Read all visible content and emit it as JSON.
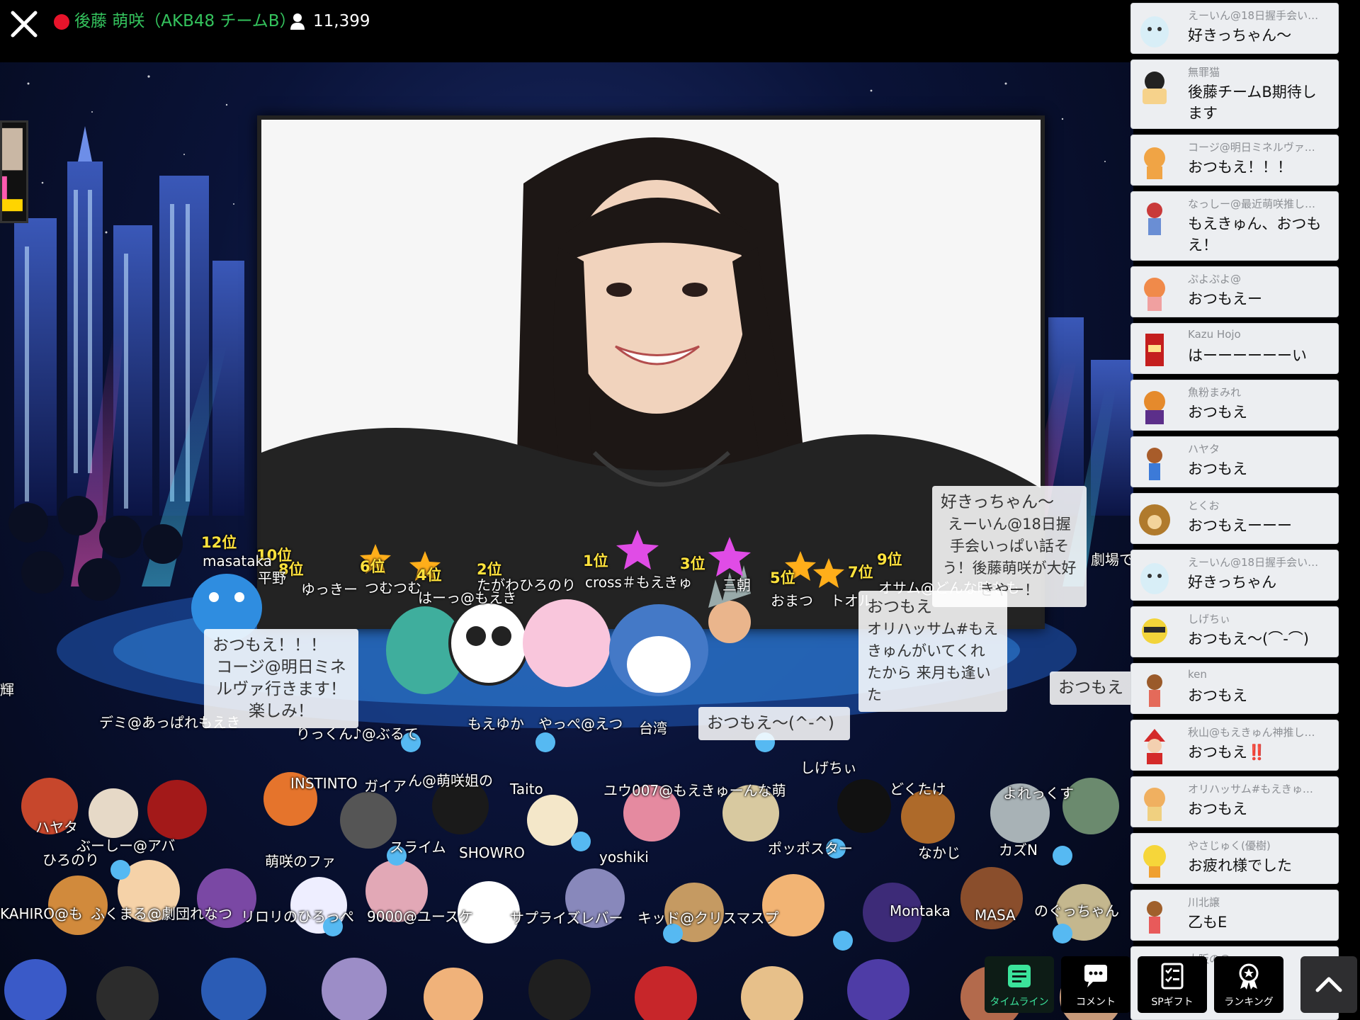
{
  "header": {
    "streamer_name": "後藤 萌咲（AKB48 チームB）",
    "viewer_count": "11,399"
  },
  "stage": {
    "ranks": [
      "12位",
      "10位",
      "8位",
      "6位",
      "4位",
      "2位",
      "1位",
      "3位",
      "5位",
      "7位",
      "9位"
    ],
    "floating_names": [
      "masataka",
      "平野",
      "ゆっきー",
      "つむつむ",
      "はーっ@もえき",
      "たがわひろのり",
      "cross＃もえきゅ",
      "三朝",
      "おまつ",
      "トオル",
      "オサム@どんな時もも",
      "劇場で",
      "輝",
      "デミ@あっぱれもえき",
      "りっくん♪@ぶるて",
      "もえゆか",
      "やっぺ@えつ",
      "台湾",
      "INSTINTO",
      "ガイア",
      "ん@萌咲姐の",
      "Taito",
      "ユウ007@もえきゅーんな萌",
      "どくたけ",
      "よれっくす",
      "ひろのり",
      "ぶーしー@アバ",
      "萌咲のファ",
      "スライム",
      "SHOWRO",
      "yoshiki",
      "ポッポスター",
      "なかじ",
      "カズN",
      "KAHIRO@も",
      "ふくまる@劇団れなつ",
      "リロリのひろっぺ",
      "9000@ユースケ",
      "サプライズレバー",
      "キッド@クリスマスプ",
      "Montaka",
      "MASA",
      "のぐっちゃん",
      "ハヤタ",
      "しげちぃ"
    ],
    "bubbles": {
      "b1": "好きっちゃん〜",
      "b2": "えーいん@18日握手会いっぱい話そう！後藤萌咲が大好きやー！",
      "b3": "おつもえ！！！",
      "b4": "コージ@明日ミネルヴァ行きます！楽しみ！",
      "b5": "おつもえ",
      "b6": "オリハッサム#もえきゅんがいてくれたから 来月も逢いた",
      "b7": "おつもえ〜(^-^)",
      "b8": "おつもえ"
    }
  },
  "timeline": {
    "items": [
      {
        "user": "えーいん@18日握手会い…",
        "text": "好きっちゃん〜"
      },
      {
        "user": "無罪猫",
        "text": "後藤チームB期待します"
      },
      {
        "user": "コージ@明日ミネルヴァ…",
        "text": "おつもえ！！！"
      },
      {
        "user": "なっしー@最近萌咲推し…",
        "text": "もえきゅん、おつもえ！"
      },
      {
        "user": "ぷよぷよ@",
        "text": "おつもえー"
      },
      {
        "user": "Kazu Hojo",
        "text": "はーーーーーーい"
      },
      {
        "user": "魚粉まみれ",
        "text": "おつもえ"
      },
      {
        "user": "ハヤタ",
        "text": "おつもえ"
      },
      {
        "user": "とくお",
        "text": "おつもえーーー"
      },
      {
        "user": "えーいん@18日握手会い…",
        "text": "好きっちゃん"
      },
      {
        "user": "しげちぃ",
        "text": "おつもえ〜(⌒-⌒)"
      },
      {
        "user": "ken",
        "text": "おつもえ"
      },
      {
        "user": "秋山@もえきゅん神推し…",
        "text": "おつもえ‼️"
      },
      {
        "user": "オリハッサム#もえきゅ…",
        "text": "おつもえ"
      },
      {
        "user": "やさじゅく(優樹)",
        "text": "お疲れ様でした"
      },
      {
        "user": "川北譲",
        "text": "乙もE"
      },
      {
        "user": "大阪の@",
        "text": ""
      }
    ]
  },
  "toolbar": {
    "timeline_label": "タイムライン",
    "comment_label": "コメント",
    "gift_label": "SPギフト",
    "ranking_label": "ランキング"
  },
  "colors": {
    "accent_green": "#3be39b",
    "live_red": "#e8142b",
    "name_green": "#34c35d"
  }
}
